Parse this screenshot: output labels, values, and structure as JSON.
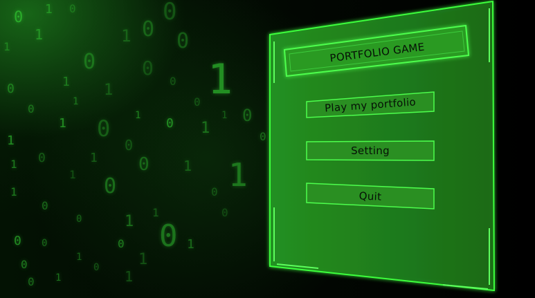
{
  "menu": {
    "title": "PORTFOLIO GAME",
    "buttons": [
      {
        "label": "Play my portfolio"
      },
      {
        "label": "Setting"
      },
      {
        "label": "Quit"
      }
    ]
  },
  "background": {
    "digits": [
      "0",
      "1",
      "0",
      "0",
      "1",
      "0",
      "1",
      "1",
      "0",
      "1",
      "0",
      "0",
      "1",
      "0",
      "1",
      "0",
      "1",
      "1",
      "0",
      "0",
      "1",
      "0",
      "1",
      "0",
      "0",
      "1",
      "1",
      "0",
      "1",
      "0",
      "0",
      "1",
      "1",
      "0",
      "1",
      "0",
      "0",
      "1",
      "0",
      "0",
      "1",
      "1",
      "0",
      "1",
      "0",
      "0",
      "1",
      "0",
      "1",
      "1",
      "0",
      "0",
      "1",
      "0",
      "1",
      "0"
    ]
  },
  "colors": {
    "panel_fill": "#1f7a1a",
    "panel_border": "#3cff3c",
    "button_fill": "#2a8f22",
    "text": "#061006"
  }
}
